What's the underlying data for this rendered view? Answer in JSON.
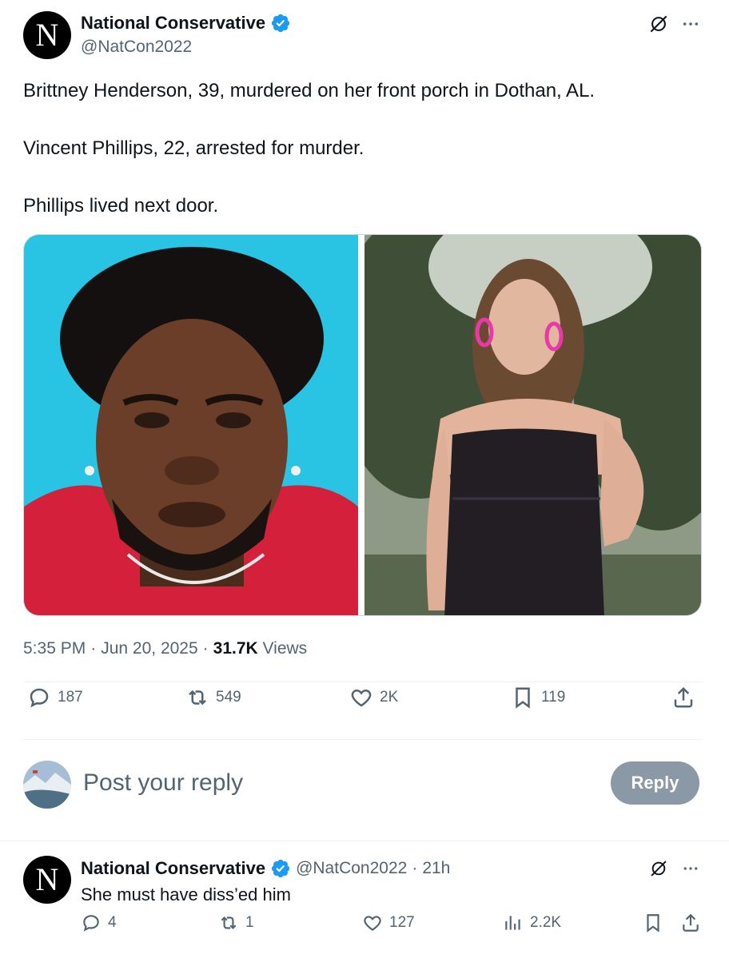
{
  "post": {
    "avatar_letter": "N",
    "display_name": "National Conservative",
    "handle": "@NatCon2022",
    "text_lines": [
      "Brittney Henderson, 39, murdered on her front porch in Dothan, AL.",
      "Vincent Phillips, 22, arrested for murder.",
      "Phillips lived next door."
    ],
    "time": "5:35 PM",
    "date": "Jun 20, 2025",
    "views_count": "31.7K",
    "views_label": "Views",
    "separator": "·",
    "stats": {
      "replies": "187",
      "reposts": "549",
      "likes": "2K",
      "bookmarks": "119"
    }
  },
  "reply_composer": {
    "placeholder": "Post your reply",
    "button_label": "Reply"
  },
  "reply": {
    "avatar_letter": "N",
    "display_name": "National Conservative",
    "handle": "@NatCon2022",
    "age": "21h",
    "separator": "·",
    "text": "She must have diss’ed him",
    "stats": {
      "replies": "4",
      "reposts": "1",
      "likes": "127",
      "views": "2.2K"
    }
  },
  "colors": {
    "text_primary": "#0f1419",
    "text_secondary": "#536471",
    "verified_blue": "#1d9bf0",
    "reply_button": "#8b98a5",
    "divider": "#eff3f4"
  }
}
